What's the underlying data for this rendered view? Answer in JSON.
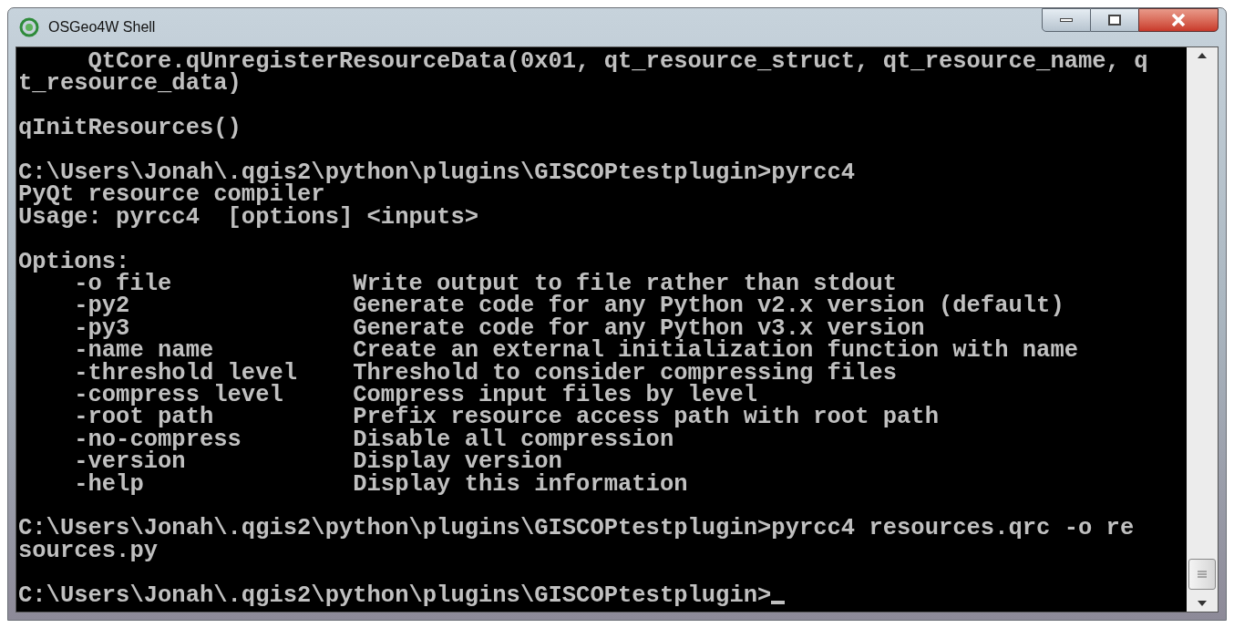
{
  "window": {
    "title": "OSGeo4W Shell"
  },
  "console": {
    "blocks": [
      [
        "     QtCore.qUnregisterResourceData(0x01, qt_resource_struct, qt_resource_name, q",
        "t_resource_data)"
      ],
      [
        "qInitResources()"
      ],
      [
        "C:\\Users\\Jonah\\.qgis2\\python\\plugins\\GISCOPtestplugin>pyrcc4",
        "PyQt resource compiler",
        "Usage: pyrcc4  [options] <inputs>"
      ],
      [
        "Options:",
        "    -o file             Write output to file rather than stdout",
        "    -py2                Generate code for any Python v2.x version (default)",
        "    -py3                Generate code for any Python v3.x version",
        "    -name name          Create an external initialization function with name",
        "    -threshold level    Threshold to consider compressing files",
        "    -compress level     Compress input files by level",
        "    -root path          Prefix resource access path with root path",
        "    -no-compress        Disable all compression",
        "    -version            Display version",
        "    -help               Display this information"
      ],
      [
        "C:\\Users\\Jonah\\.qgis2\\python\\plugins\\GISCOPtestplugin>pyrcc4 resources.qrc -o re",
        "sources.py"
      ],
      [
        "C:\\Users\\Jonah\\.qgis2\\python\\plugins\\GISCOPtestplugin>"
      ]
    ],
    "cursor": true
  }
}
